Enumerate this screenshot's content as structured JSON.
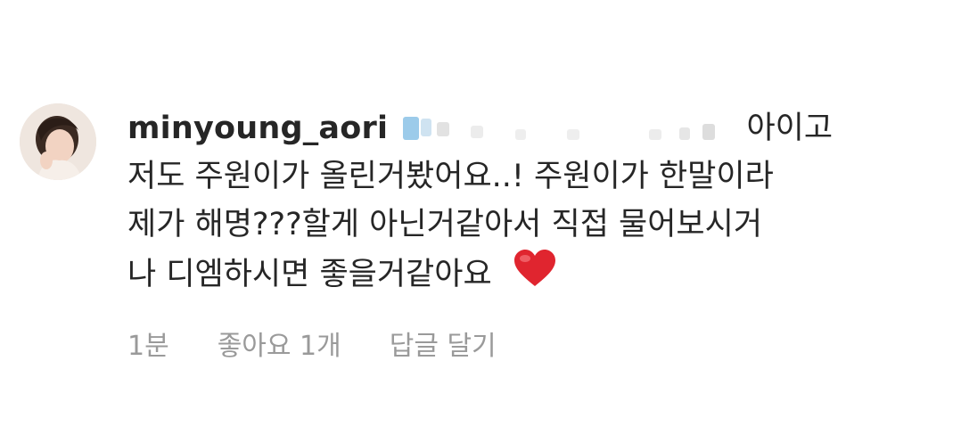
{
  "comment": {
    "username": "minyoung_aori",
    "text_lines": [
      "아이고",
      "저도 주원이가 올린거봤어요..! 주원이가 한말이라",
      "제가 해명???할게 아닌거같아서 직접 물어보시거",
      "나 디엠하시면 좋을거같아요"
    ],
    "emoji": "heart-icon",
    "mention_blurred": true
  },
  "meta": {
    "time": "1분",
    "likes": "좋아요 1개",
    "reply": "답글 달기"
  },
  "colors": {
    "text": "#262626",
    "meta": "#9a9a9a",
    "heart": "#e0252f"
  }
}
